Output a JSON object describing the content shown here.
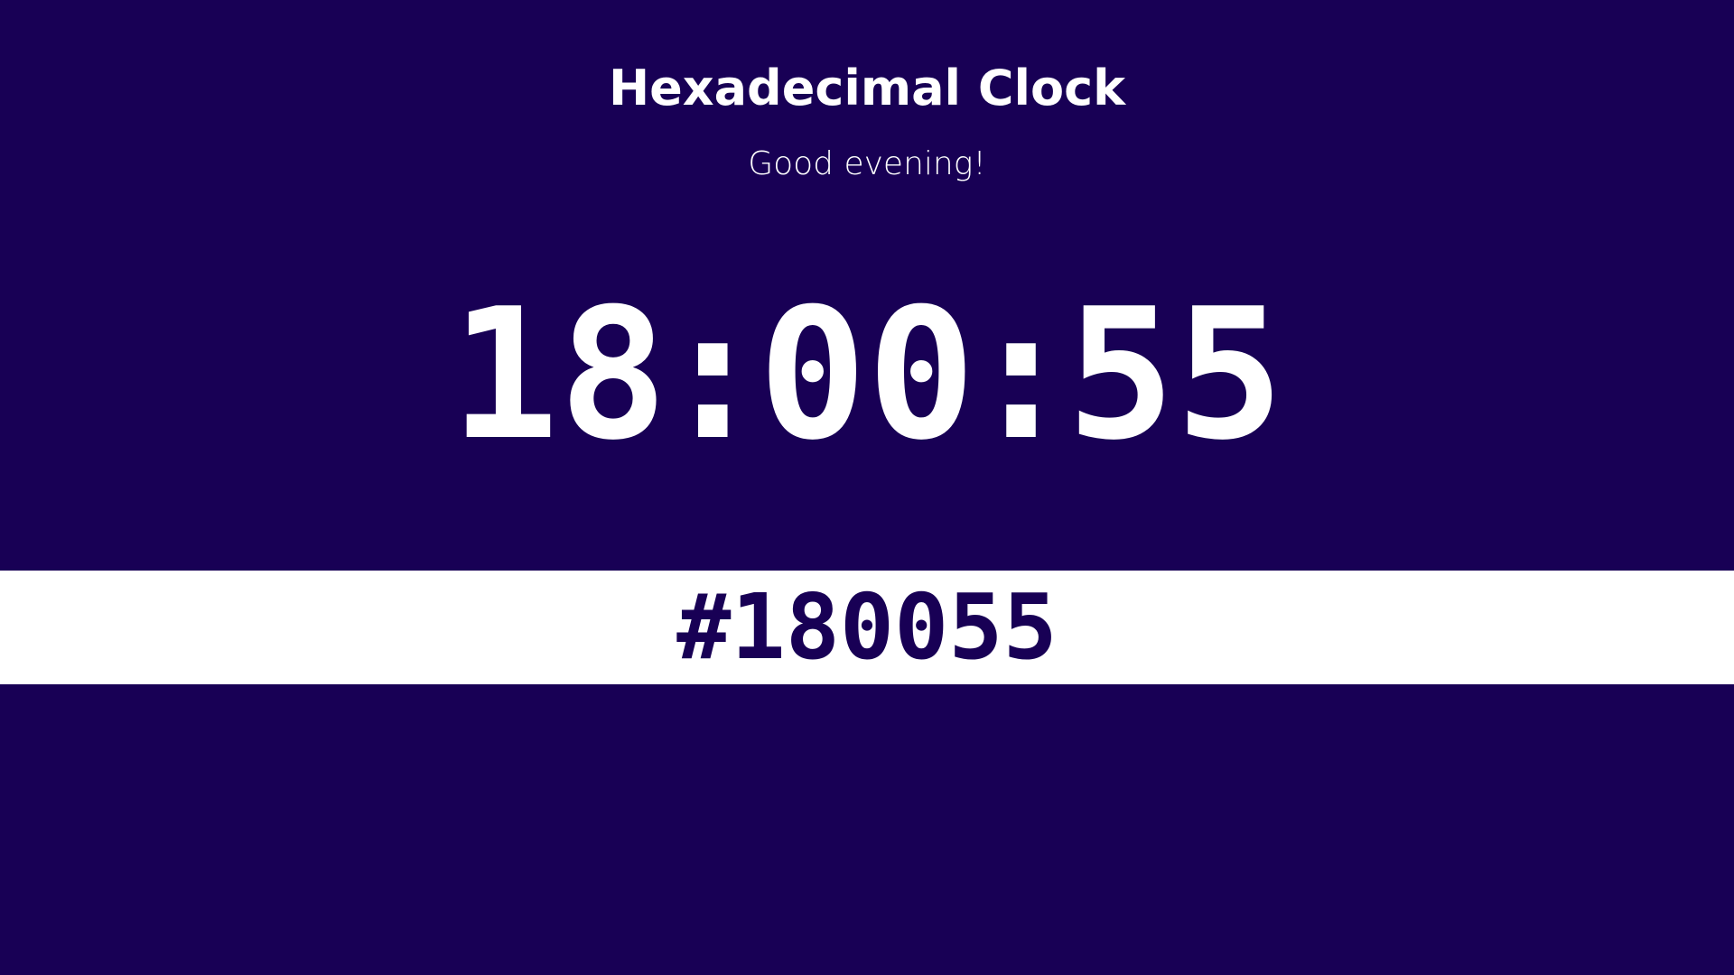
{
  "header": {
    "title": "Hexadecimal Clock",
    "greeting": "Good evening!"
  },
  "clock": {
    "hours": "18",
    "minutes": "00",
    "seconds": "55",
    "separator": ":"
  },
  "hex": {
    "value": "#180055"
  },
  "colors": {
    "background": "#180055",
    "band": "#ffffff",
    "text": "#ffffff"
  }
}
